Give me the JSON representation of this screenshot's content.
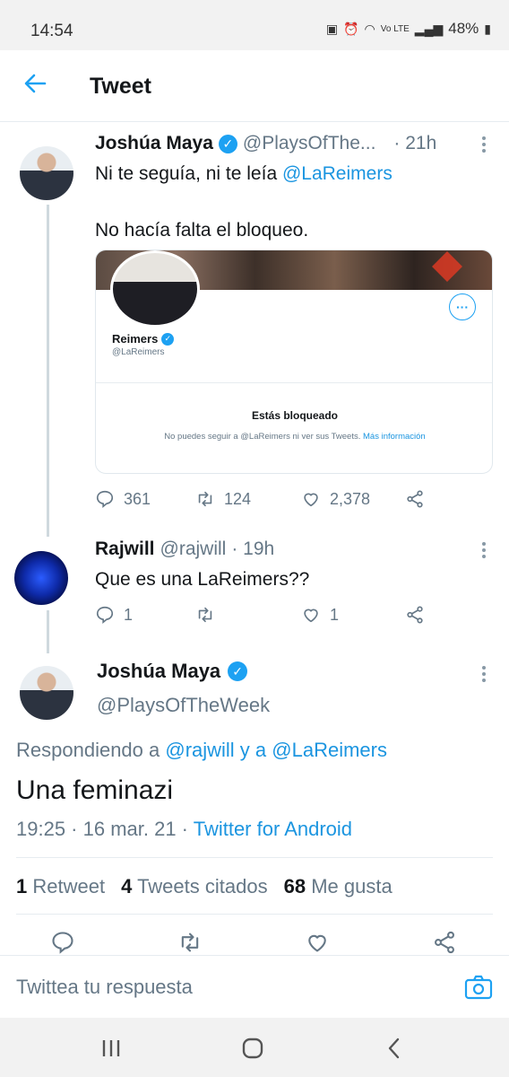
{
  "status_bar": {
    "time": "14:54",
    "network": "Vo LTE",
    "battery": "48%"
  },
  "app_bar": {
    "title": "Tweet"
  },
  "tweet1": {
    "name": "Joshúa Maya",
    "handle": "@PlaysOfThe...",
    "time": "· 21h",
    "line1_text": "Ni te seguía, ni te leía ",
    "line1_mention": "@LaReimers",
    "line2": "No hacía falta el bloqueo.",
    "card": {
      "more": "···",
      "name": "Reimers",
      "handle": "@LaReimers",
      "blocked_title": "Estás bloqueado",
      "blocked_sub": "No puedes seguir a @LaReimers ni ver sus Tweets.",
      "more_info": "Más información"
    },
    "replies": "361",
    "retweets": "124",
    "likes": "2,378"
  },
  "tweet2": {
    "name": "Rajwill",
    "handle": "@rajwill",
    "time": "· 19h",
    "text": "Que es una LaReimers??",
    "replies": "1",
    "likes": "1"
  },
  "main_tweet": {
    "name": "Joshúa Maya",
    "handle": "@PlaysOfTheWeek",
    "replying_prefix": "Respondiendo a ",
    "replying_to": "@rajwill y a @LaReimers",
    "text": "Una feminazi",
    "timestamp": "19:25 · 16 mar. 21 · ",
    "source": "Twitter for Android",
    "stats": {
      "retweets_count": "1",
      "retweets_label": "Retweet",
      "quotes_count": "4",
      "quotes_label": "Tweets citados",
      "likes_count": "68",
      "likes_label": "Me gusta"
    }
  },
  "reply": {
    "placeholder": "Twittea tu respuesta"
  },
  "colors": {
    "accent": "#1da1f2",
    "link": "#1b95e0",
    "muted": "#657786"
  }
}
